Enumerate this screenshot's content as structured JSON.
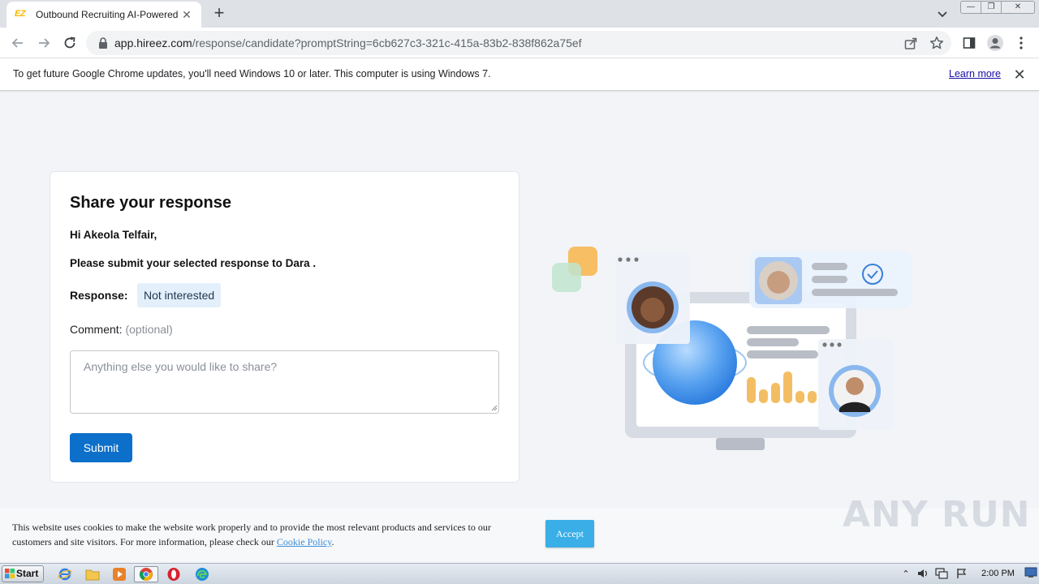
{
  "browser": {
    "tab": {
      "favicon_text": "EZ",
      "title": "Outbound Recruiting AI-Powered Platform"
    },
    "new_tab": "+",
    "window_controls": {
      "minimize": "—",
      "maximize": "❐",
      "close": "✕"
    },
    "url": {
      "host": "app.hireez.com",
      "path": "/response/candidate?promptString=6cb627c3-321c-415a-83b2-838f862a75ef"
    },
    "infobar": {
      "message": "To get future Google Chrome updates, you'll need Windows 10 or later. This computer is using Windows 7.",
      "link": "Learn more",
      "close": "✕"
    }
  },
  "form": {
    "title": "Share your response",
    "greeting": "Hi Akeola Telfair,",
    "instruction": "Please submit your selected response to Dara .",
    "response_label": "Response:",
    "response_value": "Not interested",
    "comment_label": "Comment:",
    "comment_optional": "(optional)",
    "comment_placeholder": "Anything else you would like to share?",
    "submit_label": "Submit"
  },
  "cookie_banner": {
    "text": "This website uses cookies to make the website work properly and to provide the most relevant products and services to our customers and site visitors. For more information, please check our",
    "link": "Cookie Policy",
    "suffix": ".",
    "accept": "Accept"
  },
  "watermark": "ANY RUN",
  "taskbar": {
    "start": "Start",
    "clock": "2:00 PM"
  },
  "colors": {
    "primary_button": "#0c6fc9",
    "response_chip_bg": "#e3f0fc",
    "accept_button": "#3aaee6",
    "page_bg": "#f3f4f8"
  }
}
